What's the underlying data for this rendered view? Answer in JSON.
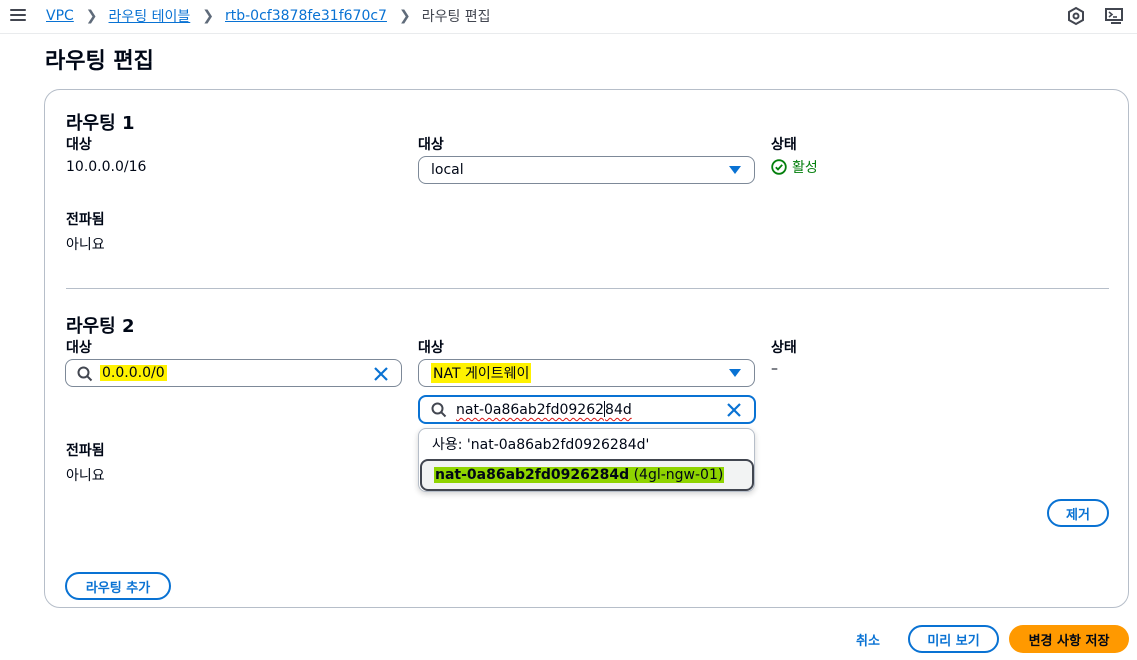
{
  "breadcrumb": {
    "items": [
      "VPC",
      "라우팅 테이블",
      "rtb-0cf3878fe31f670c7"
    ],
    "current": "라우팅 편집"
  },
  "page": {
    "title": "라우팅 편집"
  },
  "routes": [
    {
      "title": "라우팅 1",
      "destination_label": "대상",
      "destination_value": "10.0.0.0/16",
      "target_label": "대상",
      "target_value": "local",
      "status_label": "상태",
      "status_value": "활성",
      "propagated_label": "전파됨",
      "propagated_value": "아니요"
    },
    {
      "title": "라우팅 2",
      "destination_label": "대상",
      "destination_value": "0.0.0.0/0",
      "target_label": "대상",
      "target_value": "NAT 게이트웨이",
      "target_search_value_a": "nat-0a86ab2fd09262",
      "target_search_value_b": "84d",
      "status_label": "상태",
      "status_value": "–",
      "propagated_label": "전파됨",
      "propagated_value": "아니요",
      "dropdown": {
        "use_option": "사용: 'nat-0a86ab2fd0926284d'",
        "match_id": "nat-0a86ab2fd0926284d",
        "match_name": " (4gl-ngw-01)"
      },
      "remove_label": "제거"
    }
  ],
  "add_route_label": "라우팅 추가",
  "footer": {
    "cancel_label": "취소",
    "preview_label": "미리 보기",
    "save_label": "변경 사항 저장"
  },
  "icons": {
    "top_right_1": "hexagon-settings-icon",
    "top_right_2": "cloudshell-icon"
  },
  "colors": {
    "link": "#0972d3",
    "primary": "#ff9900",
    "success": "#037f0c",
    "highlight_yellow": "#fff200",
    "highlight_green": "#8fd400"
  }
}
